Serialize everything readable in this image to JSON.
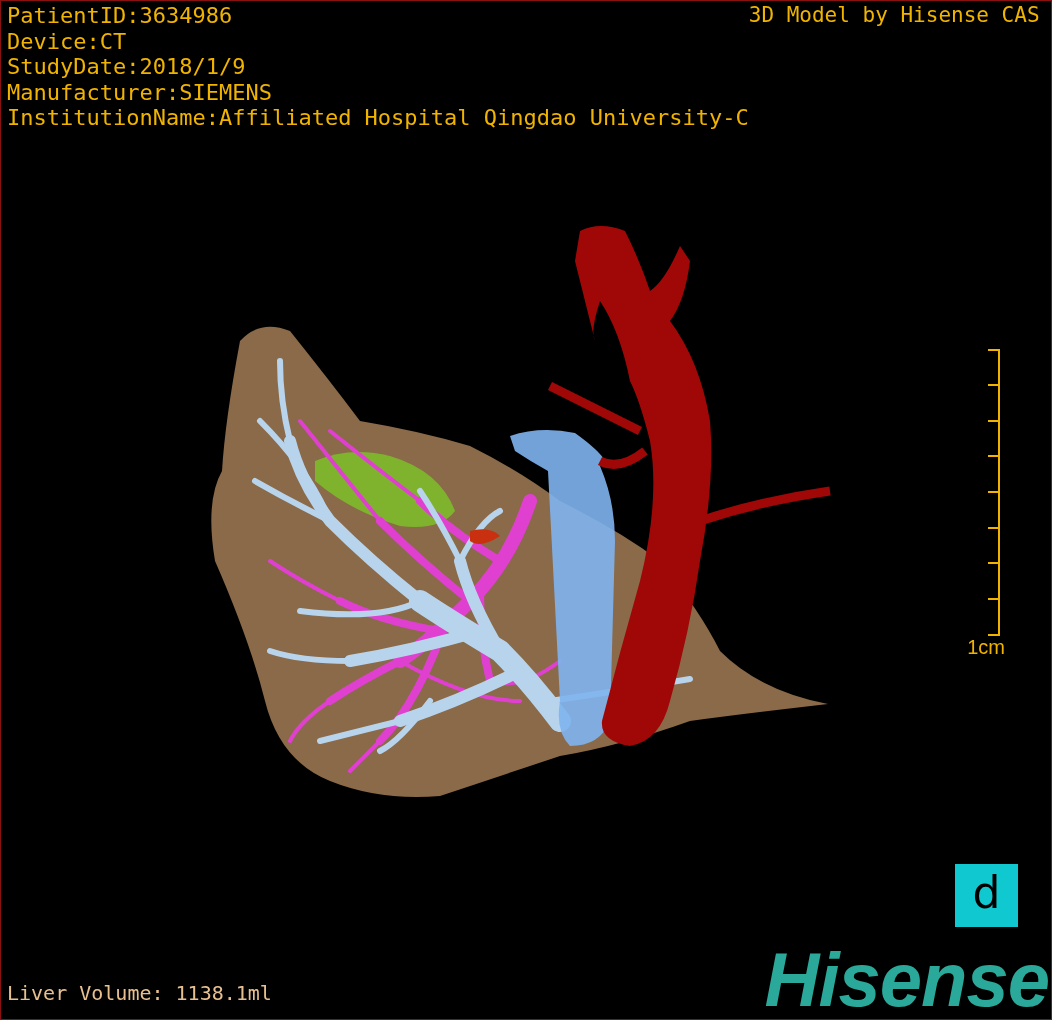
{
  "info_lines": [
    "PatientID:3634986",
    "Device:CT",
    "StudyDate:2018/1/9",
    "Manufacturer:SIEMENS",
    "InstitutionName:Affiliated Hospital Qingdao University-C"
  ],
  "viewer_title": "3D Model by Hisense CAS",
  "scale_bar": {
    "label": "1cm"
  },
  "liver_volume": "Liver Volume: 1138.1ml",
  "app_badge": "d",
  "brand_logo": "Hisense"
}
